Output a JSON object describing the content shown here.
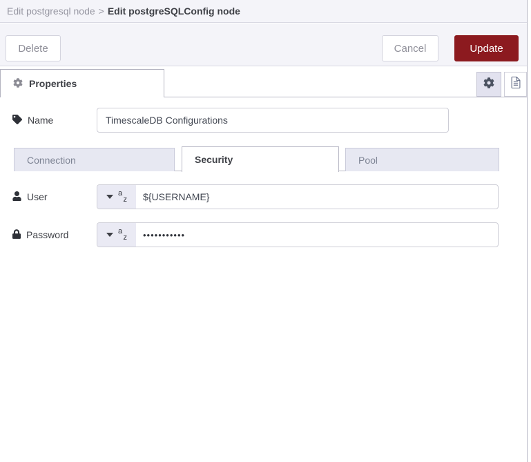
{
  "breadcrumb": {
    "parent": "Edit postgresql node",
    "separator": ">",
    "current": "Edit postgreSQLConfig node"
  },
  "toolbar": {
    "delete_label": "Delete",
    "cancel_label": "Cancel",
    "update_label": "Update"
  },
  "editor_tab": {
    "label": "Properties"
  },
  "icons": {
    "properties_tab": "gear",
    "settings_button": "gear",
    "docs_button": "document",
    "name_field": "tag",
    "user_field": "person",
    "password_field": "lock",
    "type_select": "caret-down",
    "type_string": "a-z"
  },
  "form": {
    "name": {
      "label": "Name",
      "value": "TimescaleDB Configurations"
    },
    "tabs": [
      {
        "label": "Connection",
        "active": false
      },
      {
        "label": "Security",
        "active": true
      },
      {
        "label": "Pool",
        "active": false
      }
    ],
    "user": {
      "label": "User",
      "value": "${USERNAME}",
      "type_glyph_top": "a",
      "type_glyph_bottom": "z"
    },
    "password": {
      "label": "Password",
      "value": "•••••••••••",
      "type_glyph_top": "a",
      "type_glyph_bottom": "z"
    }
  },
  "colors": {
    "header_bg": "#f4f4f9",
    "update_red": "#8c1a1f",
    "tab_inactive_bg": "#e7e8f2",
    "selected_icon_btn_bg": "#e2e2ef",
    "border": "#b9b9c6",
    "input_border": "#cdcdd6"
  }
}
